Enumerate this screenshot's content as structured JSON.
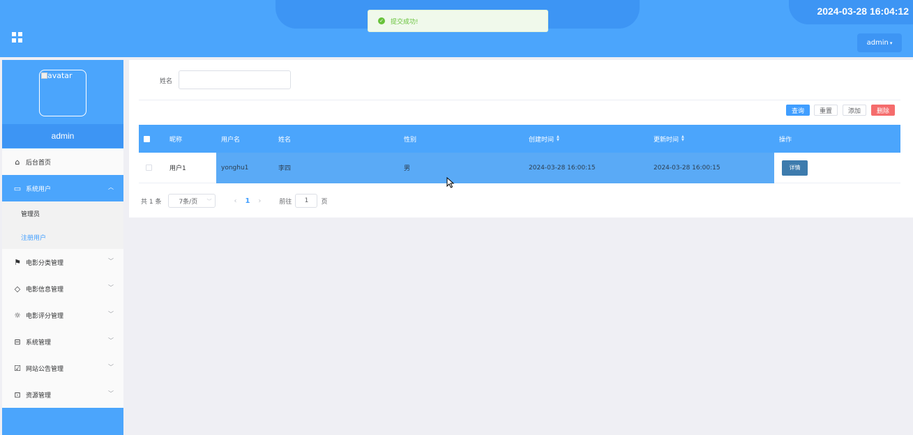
{
  "header": {
    "clock": "2024-03-28 16:04:12",
    "user_menu": "admin",
    "caret": "▾"
  },
  "toast": {
    "icon": "✓",
    "message": "提交成功!"
  },
  "sidebar": {
    "avatar_alt": "avatar",
    "username": "admin",
    "items": [
      {
        "label": "后台首页",
        "icon": "home-icon",
        "glyph": "⌂"
      },
      {
        "label": "系统用户",
        "icon": "monitor-icon",
        "glyph": "▭",
        "arrow": "︿"
      },
      {
        "label": "电影分类管理",
        "icon": "bookmark-icon",
        "glyph": "⚑",
        "arrow": "﹀"
      },
      {
        "label": "电影信息管理",
        "icon": "tag-icon",
        "glyph": "◇",
        "arrow": "﹀"
      },
      {
        "label": "电影评分管理",
        "icon": "sun-icon",
        "glyph": "☼",
        "arrow": "﹀"
      },
      {
        "label": "系统管理",
        "icon": "inbox-icon",
        "glyph": "⊟",
        "arrow": "﹀"
      },
      {
        "label": "网站公告管理",
        "icon": "clipboard-icon",
        "glyph": "☑",
        "arrow": "﹀"
      },
      {
        "label": "资源管理",
        "icon": "message-icon",
        "glyph": "⊡",
        "arrow": "﹀"
      }
    ],
    "sub_items": [
      "管理员",
      "注册用户"
    ]
  },
  "search": {
    "label": "姓名",
    "value": ""
  },
  "toolbar": {
    "query": "查询",
    "reset": "重置",
    "add": "添加",
    "delete": "删除"
  },
  "table": {
    "headers": [
      "昵称",
      "用户名",
      "姓名",
      "性别",
      "创建时间",
      "更新时间",
      "操作"
    ],
    "rows": [
      {
        "nickname": "用户1",
        "username": "yonghu1",
        "name": "李四",
        "gender": "男",
        "created": "2024-03-28 16:00:15",
        "updated": "2024-03-28 16:00:15",
        "action": "详情"
      }
    ]
  },
  "pagination": {
    "total": "共 1 条",
    "page_size": "7条/页",
    "prev": "‹",
    "next": "›",
    "current": "1",
    "goto_label": "前往",
    "goto_value": "1",
    "page_suffix": "页"
  },
  "colors": {
    "primary": "#4ba5fc",
    "primary_dark": "#3d95f4",
    "success": "#67c23a",
    "danger": "#f56c6c"
  }
}
